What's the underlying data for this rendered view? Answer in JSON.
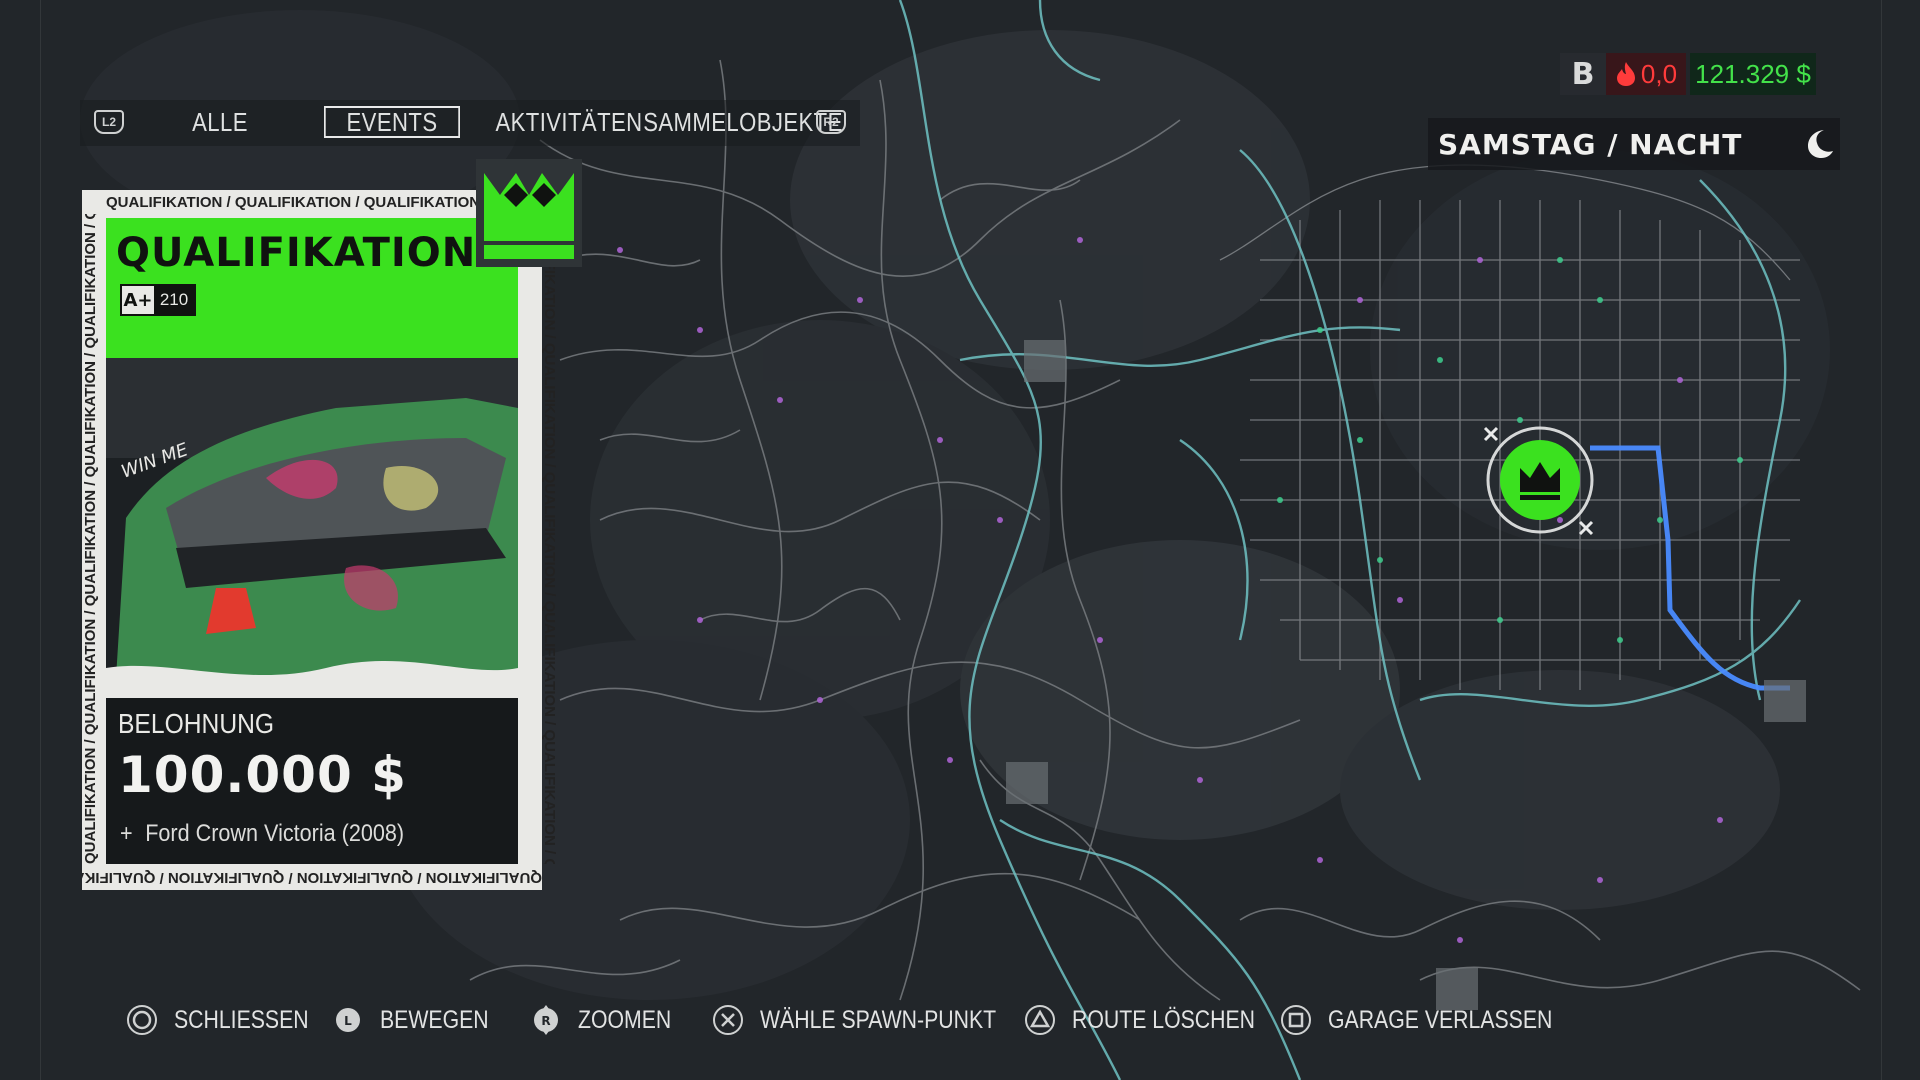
{
  "tabs": {
    "left_button": "L2",
    "right_button": "R2",
    "items": [
      {
        "label": "ALLE",
        "active": false
      },
      {
        "label": "EVENTS",
        "active": true
      },
      {
        "label": "AKTIVITÄTEN",
        "active": false
      },
      {
        "label": "SAMMELOBJEKTE",
        "active": false
      }
    ]
  },
  "event_card": {
    "border_text": "QUALIFIKATION / QUALIFIKATION / QUALIFIKATION / QUALIFIKATION / QUALIFIKATION / QUALIFIKATION",
    "title": "QUALIFIKATION",
    "rating_class": "A+",
    "rating_value": "210",
    "car_decal_text": "WIN ME",
    "reward_label": "BELOHNUNG",
    "reward_amount": "100.000 $",
    "reward_extra_prefix": "+",
    "reward_extra_item": "Ford Crown Victoria (2008)",
    "accent_color": "#3be11f"
  },
  "hud": {
    "heat_class": "B",
    "heat_level": "0,0",
    "money": "121.329 $",
    "time_of_day": "SAMSTAG / NACHT",
    "heat_color": "#ff3b3b",
    "money_color": "#43e24a"
  },
  "map": {
    "event_marker_icon": "crown-icon",
    "route_color": "#4a8bff",
    "highway_color": "#6fc2c3"
  },
  "prompts": [
    {
      "icon": "circle-button-icon",
      "label": "SCHLIESSEN"
    },
    {
      "icon": "left-stick-icon",
      "label": "BEWEGEN"
    },
    {
      "icon": "right-stick-icon",
      "label": "ZOOMEN"
    },
    {
      "icon": "cross-button-icon",
      "label": "WÄHLE SPAWN-PUNKT"
    },
    {
      "icon": "triangle-button-icon",
      "label": "ROUTE LÖSCHEN"
    },
    {
      "icon": "square-button-icon",
      "label": "GARAGE VERLASSEN"
    }
  ]
}
